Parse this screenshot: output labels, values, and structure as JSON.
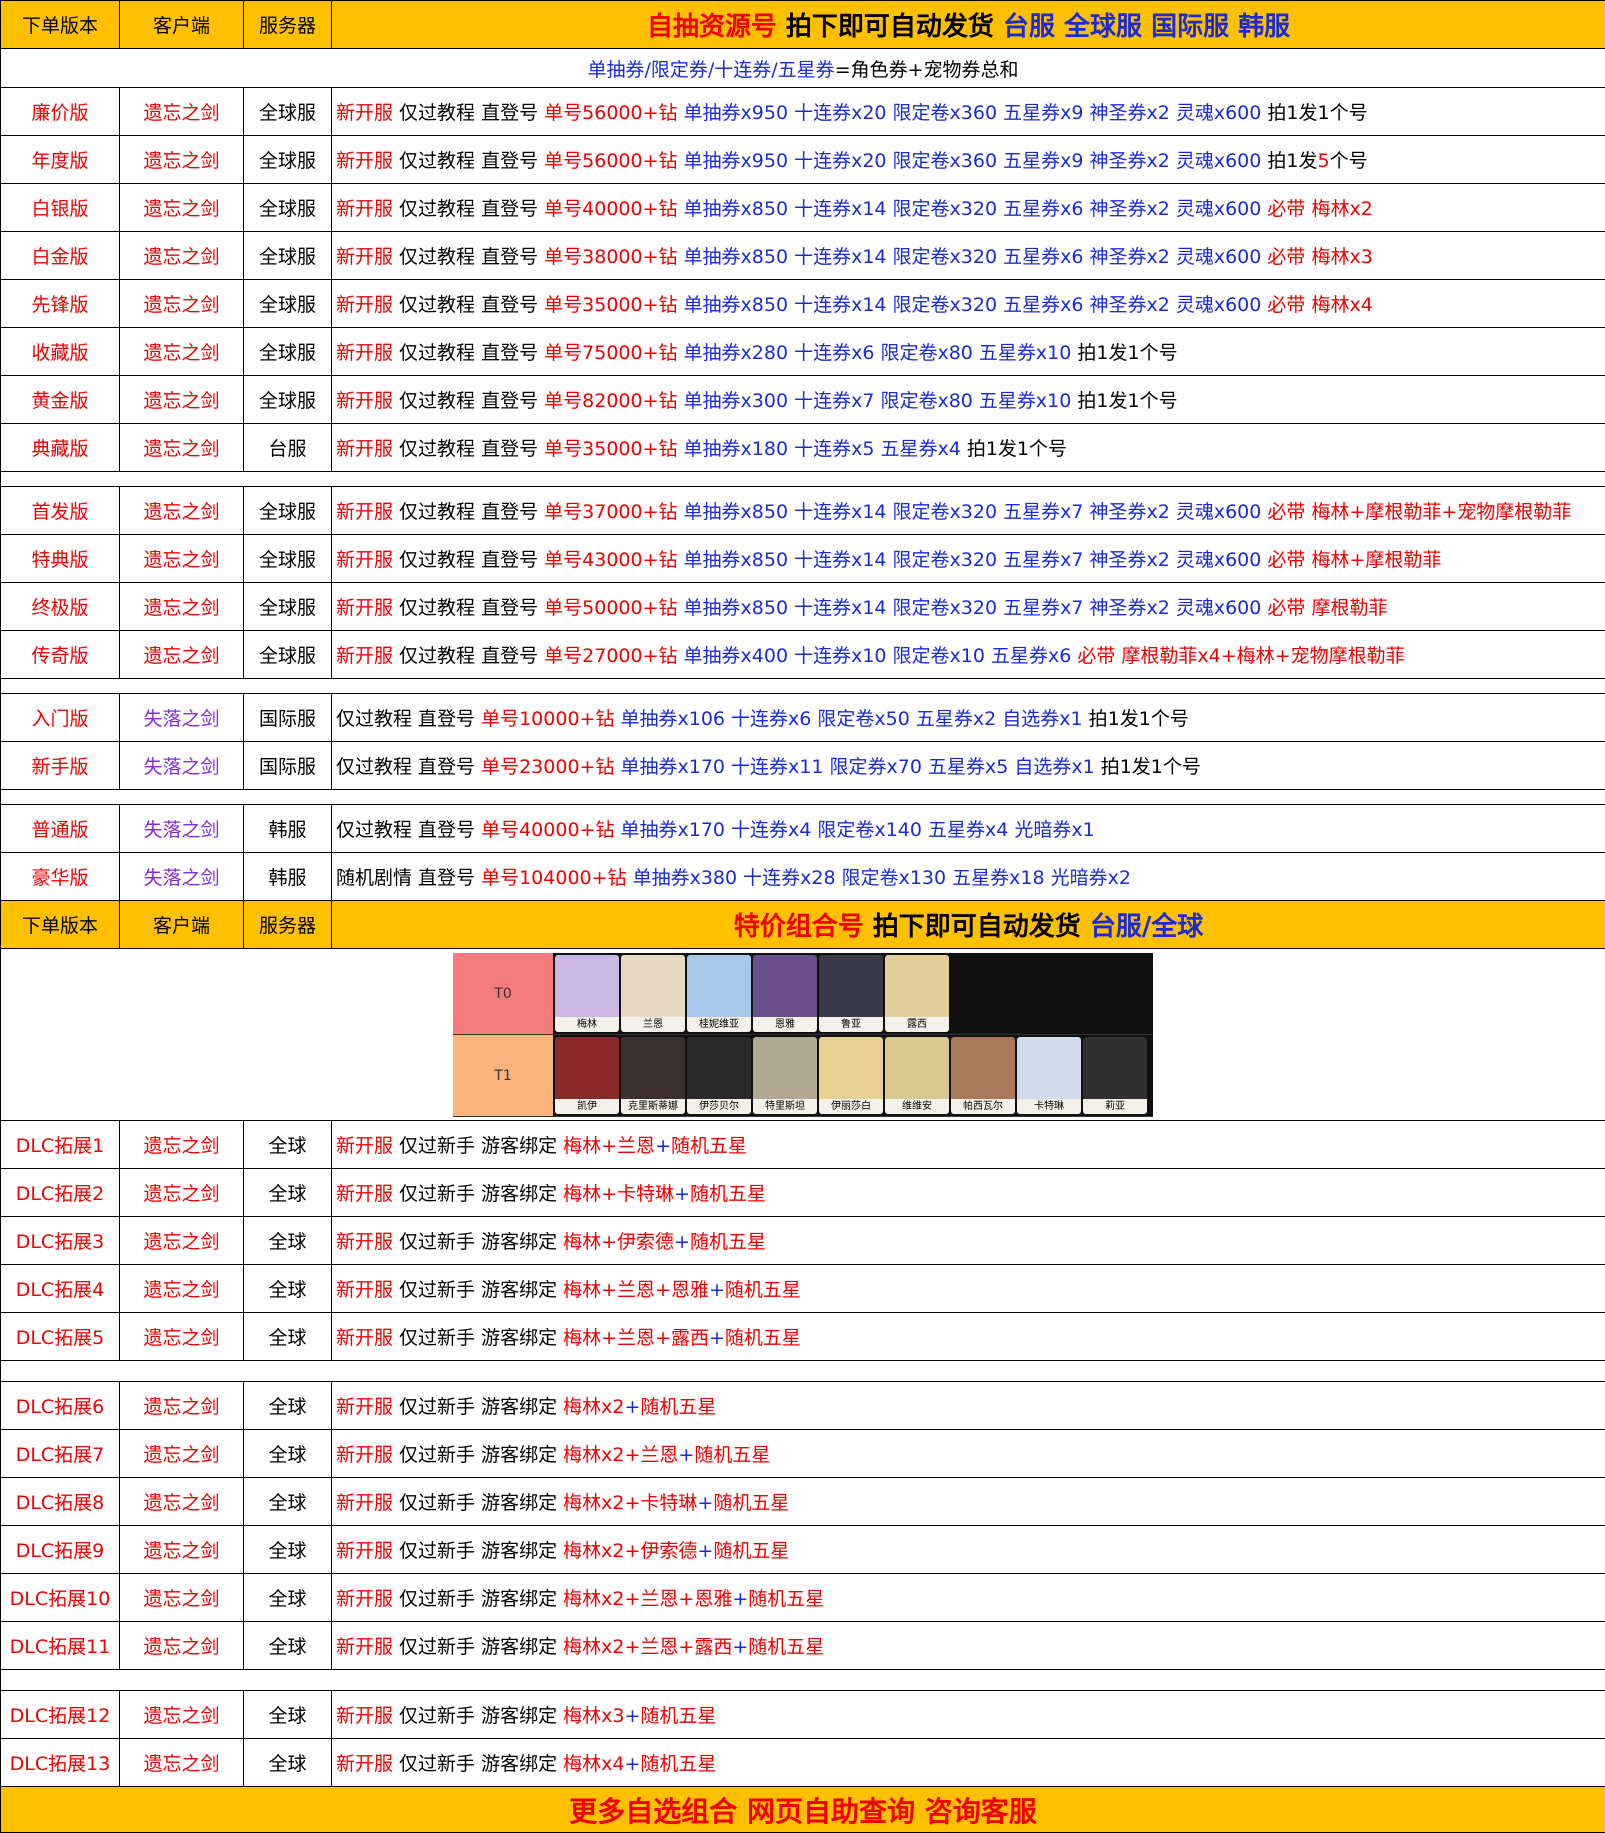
{
  "header": {
    "col_version": "下单版本",
    "col_client": "客户端",
    "col_server": "服务器",
    "title_parts": [
      {
        "t": "自抽资源号 ",
        "c": "red"
      },
      {
        "t": "拍下即可自动发货 ",
        "c": "blk"
      },
      {
        "t": "台服 全球服 国际服 韩服",
        "c": "blue"
      }
    ]
  },
  "subheader": [
    {
      "t": "单抽券/限定券/十连券/五星券",
      "c": "blue"
    },
    {
      "t": "=角色券+宠物券总和",
      "c": "blk"
    }
  ],
  "group1": [
    {
      "ver": "廉价版",
      "client": "遗忘之剑",
      "server": "全球服",
      "parts": [
        {
          "t": "新开服 ",
          "c": "red"
        },
        {
          "t": "仅过教程 直登号 ",
          "c": "blk"
        },
        {
          "t": "单号56000+钻 ",
          "c": "red"
        },
        {
          "t": "单抽券x950 十连券x20  限定卷x360 五星券x9 神圣券x2 灵魂x600 ",
          "c": "blue"
        },
        {
          "t": "拍1发1个号",
          "c": "blk"
        }
      ]
    },
    {
      "ver": "年度版",
      "client": "遗忘之剑",
      "server": "全球服",
      "parts": [
        {
          "t": "新开服 ",
          "c": "red"
        },
        {
          "t": "仅过教程 直登号 ",
          "c": "blk"
        },
        {
          "t": "单号56000+钻 ",
          "c": "red"
        },
        {
          "t": "单抽券x950 十连券x20  限定卷x360 五星券x9 神圣券x2 灵魂x600 ",
          "c": "blue"
        },
        {
          "t": "拍1发",
          "c": "blk"
        },
        {
          "t": "5",
          "c": "red"
        },
        {
          "t": "个号",
          "c": "blk"
        }
      ]
    },
    {
      "ver": "白银版",
      "client": "遗忘之剑",
      "server": "全球服",
      "parts": [
        {
          "t": "新开服 ",
          "c": "red"
        },
        {
          "t": "仅过教程 直登号 ",
          "c": "blk"
        },
        {
          "t": "单号40000+钻 ",
          "c": "red"
        },
        {
          "t": "单抽券x850 十连券x14  限定卷x320 五星券x6 神圣券x2 灵魂x600  ",
          "c": "blue"
        },
        {
          "t": "必带 梅林x2",
          "c": "red"
        }
      ]
    },
    {
      "ver": "白金版",
      "client": "遗忘之剑",
      "server": "全球服",
      "parts": [
        {
          "t": "新开服 ",
          "c": "red"
        },
        {
          "t": "仅过教程 直登号 ",
          "c": "blk"
        },
        {
          "t": "单号38000+钻 ",
          "c": "red"
        },
        {
          "t": "单抽券x850 十连券x14  限定卷x320 五星券x6 神圣券x2 灵魂x600  ",
          "c": "blue"
        },
        {
          "t": "必带 梅林x3",
          "c": "red"
        }
      ]
    },
    {
      "ver": "先锋版",
      "client": "遗忘之剑",
      "server": "全球服",
      "parts": [
        {
          "t": "新开服 ",
          "c": "red"
        },
        {
          "t": "仅过教程 直登号 ",
          "c": "blk"
        },
        {
          "t": "单号35000+钻 ",
          "c": "red"
        },
        {
          "t": "单抽券x850 十连券x14  限定卷x320 五星券x6 神圣券x2 灵魂x600  ",
          "c": "blue"
        },
        {
          "t": "必带 梅林x4",
          "c": "red"
        }
      ]
    },
    {
      "ver": "收藏版",
      "client": "遗忘之剑",
      "server": "全球服",
      "parts": [
        {
          "t": "新开服 ",
          "c": "red"
        },
        {
          "t": "仅过教程 直登号 ",
          "c": "blk"
        },
        {
          "t": "单号75000+钻 ",
          "c": "red"
        },
        {
          "t": "单抽券x280 十连券x6  限定卷x80 五星券x10 ",
          "c": "blue"
        },
        {
          "t": "拍1发1个号",
          "c": "blk"
        }
      ]
    },
    {
      "ver": "黄金版",
      "client": "遗忘之剑",
      "server": "全球服",
      "parts": [
        {
          "t": "新开服 ",
          "c": "red"
        },
        {
          "t": "仅过教程 直登号 ",
          "c": "blk"
        },
        {
          "t": "单号82000+钻 ",
          "c": "red"
        },
        {
          "t": "单抽券x300 十连券x7  限定卷x80 五星券x10 ",
          "c": "blue"
        },
        {
          "t": "拍1发1个号",
          "c": "blk"
        }
      ]
    },
    {
      "ver": "典藏版",
      "client": "遗忘之剑",
      "server": "台服",
      "parts": [
        {
          "t": "新开服 ",
          "c": "red"
        },
        {
          "t": "仅过教程 直登号 ",
          "c": "blk"
        },
        {
          "t": "单号35000+钻 ",
          "c": "red"
        },
        {
          "t": "单抽券x180 十连券x5  五星券x4 ",
          "c": "blue"
        },
        {
          "t": "拍1发1个号",
          "c": "blk"
        }
      ]
    }
  ],
  "group2": [
    {
      "ver": "首发版",
      "client": "遗忘之剑",
      "server": "全球服",
      "parts": [
        {
          "t": "新开服 ",
          "c": "red"
        },
        {
          "t": "仅过教程 直登号 ",
          "c": "blk"
        },
        {
          "t": "单号37000+钻 ",
          "c": "red"
        },
        {
          "t": "单抽券x850 十连券x14  限定卷x320 五星券x7 神圣券x2 灵魂x600  ",
          "c": "blue"
        },
        {
          "t": "必带 梅林+摩根勒菲+宠物摩根勒菲",
          "c": "red"
        }
      ]
    },
    {
      "ver": "特典版",
      "client": "遗忘之剑",
      "server": "全球服",
      "parts": [
        {
          "t": "新开服 ",
          "c": "red"
        },
        {
          "t": "仅过教程 直登号 ",
          "c": "blk"
        },
        {
          "t": "单号43000+钻 ",
          "c": "red"
        },
        {
          "t": "单抽券x850 十连券x14  限定卷x320 五星券x7 神圣券x2 灵魂x600  ",
          "c": "blue"
        },
        {
          "t": "必带 梅林+摩根勒菲",
          "c": "red"
        }
      ]
    },
    {
      "ver": "终极版",
      "client": "遗忘之剑",
      "server": "全球服",
      "parts": [
        {
          "t": "新开服 ",
          "c": "red"
        },
        {
          "t": "仅过教程 直登号 ",
          "c": "blk"
        },
        {
          "t": "单号50000+钻 ",
          "c": "red"
        },
        {
          "t": "单抽券x850 十连券x14  限定卷x320 五星券x7 神圣券x2 灵魂x600  ",
          "c": "blue"
        },
        {
          "t": "必带 摩根勒菲",
          "c": "red"
        }
      ]
    },
    {
      "ver": "传奇版",
      "client": "遗忘之剑",
      "server": "全球服",
      "parts": [
        {
          "t": "新开服 ",
          "c": "red"
        },
        {
          "t": "仅过教程 直登号 ",
          "c": "blk"
        },
        {
          "t": "单号27000+钻 ",
          "c": "red"
        },
        {
          "t": "单抽券x400 十连券x10  限定卷x10   五星券x6  ",
          "c": "blue"
        },
        {
          "t": "必带 摩根勒菲x4+梅林+宠物摩根勒菲",
          "c": "red"
        }
      ]
    }
  ],
  "group3": [
    {
      "ver": "入门版",
      "client": "失落之剑",
      "server": "国际服",
      "parts": [
        {
          "t": "仅过教程 直登号 ",
          "c": "blk"
        },
        {
          "t": "单号10000+钻 ",
          "c": "red"
        },
        {
          "t": "单抽券x106 十连券x6   限定卷x50 五星券x2 自选券x1 ",
          "c": "blue"
        },
        {
          "t": "拍1发1个号",
          "c": "blk"
        }
      ]
    },
    {
      "ver": "新手版",
      "client": "失落之剑",
      "server": "国际服",
      "parts": [
        {
          "t": "仅过教程 直登号 ",
          "c": "blk"
        },
        {
          "t": "单号23000+钻 ",
          "c": "red"
        },
        {
          "t": "单抽券x170 十连券x11 限定券x70 五星券x5 自选券x1 ",
          "c": "blue"
        },
        {
          "t": "拍1发1个号",
          "c": "blk"
        }
      ]
    }
  ],
  "group4": [
    {
      "ver": "普通版",
      "client": "失落之剑",
      "server": "韩服",
      "parts": [
        {
          "t": "仅过教程 直登号 ",
          "c": "blk"
        },
        {
          "t": "单号40000+钻 ",
          "c": "red"
        },
        {
          "t": "单抽券x170 十连券x4  限定卷x140  五星券x4  光暗券x1",
          "c": "blue"
        }
      ]
    },
    {
      "ver": "豪华版",
      "client": "失落之剑",
      "server": "韩服",
      "parts": [
        {
          "t": "随机剧情 直登号 ",
          "c": "blk"
        },
        {
          "t": "单号104000+钻 ",
          "c": "red"
        },
        {
          "t": "单抽券x380 十连券x28 限定卷x130 五星券x18 光暗券x2",
          "c": "blue"
        }
      ]
    }
  ],
  "header2": {
    "col_version": "下单版本",
    "col_client": "客户端",
    "col_server": "服务器",
    "title_parts": [
      {
        "t": "特价组合号 ",
        "c": "red"
      },
      {
        "t": "拍下即可自动发货 ",
        "c": "blk"
      },
      {
        "t": "台服/全球",
        "c": "blue"
      }
    ]
  },
  "tierlist": {
    "tiers": [
      {
        "label": "T0",
        "chars": [
          "梅林",
          "兰恩",
          "桂妮维亚",
          "恩雅",
          "鲁亚",
          "露西"
        ]
      },
      {
        "label": "T1",
        "chars": [
          "凯伊",
          "克里斯蒂娜",
          "伊莎贝尔",
          "特里斯坦",
          "伊丽莎白",
          "维维安",
          "帕西瓦尔",
          "卡特琳",
          "莉亚"
        ]
      }
    ]
  },
  "dlc1": [
    {
      "ver": "DLC拓展1",
      "client": "遗忘之剑",
      "server": "全球",
      "parts": [
        {
          "t": "新开服 ",
          "c": "red"
        },
        {
          "t": "仅过新手 游客绑定 ",
          "c": "blk"
        },
        {
          "t": "梅林+兰恩",
          "c": "red"
        },
        {
          "t": "+",
          "c": "blue"
        },
        {
          "t": "随机五星",
          "c": "red"
        }
      ]
    },
    {
      "ver": "DLC拓展2",
      "client": "遗忘之剑",
      "server": "全球",
      "parts": [
        {
          "t": "新开服 ",
          "c": "red"
        },
        {
          "t": "仅过新手 游客绑定 ",
          "c": "blk"
        },
        {
          "t": "梅林+卡特琳",
          "c": "red"
        },
        {
          "t": "+",
          "c": "blue"
        },
        {
          "t": "随机五星",
          "c": "red"
        }
      ]
    },
    {
      "ver": "DLC拓展3",
      "client": "遗忘之剑",
      "server": "全球",
      "parts": [
        {
          "t": "新开服 ",
          "c": "red"
        },
        {
          "t": "仅过新手 游客绑定 ",
          "c": "blk"
        },
        {
          "t": "梅林+伊索德",
          "c": "red"
        },
        {
          "t": "+",
          "c": "blue"
        },
        {
          "t": "随机五星",
          "c": "red"
        }
      ]
    },
    {
      "ver": "DLC拓展4",
      "client": "遗忘之剑",
      "server": "全球",
      "parts": [
        {
          "t": "新开服 ",
          "c": "red"
        },
        {
          "t": "仅过新手 游客绑定 ",
          "c": "blk"
        },
        {
          "t": "梅林+兰恩+恩雅",
          "c": "red"
        },
        {
          "t": "+",
          "c": "blue"
        },
        {
          "t": "随机五星",
          "c": "red"
        }
      ]
    },
    {
      "ver": "DLC拓展5",
      "client": "遗忘之剑",
      "server": "全球",
      "parts": [
        {
          "t": "新开服 ",
          "c": "red"
        },
        {
          "t": "仅过新手 游客绑定 ",
          "c": "blk"
        },
        {
          "t": "梅林+兰恩+露西",
          "c": "red"
        },
        {
          "t": "+",
          "c": "blue"
        },
        {
          "t": "随机五星",
          "c": "red"
        }
      ]
    }
  ],
  "dlc2": [
    {
      "ver": "DLC拓展6",
      "client": "遗忘之剑",
      "server": "全球",
      "parts": [
        {
          "t": "新开服 ",
          "c": "red"
        },
        {
          "t": "仅过新手 游客绑定 ",
          "c": "blk"
        },
        {
          "t": "梅林x2",
          "c": "red"
        },
        {
          "t": "+",
          "c": "blue"
        },
        {
          "t": "随机五星",
          "c": "red"
        }
      ]
    },
    {
      "ver": "DLC拓展7",
      "client": "遗忘之剑",
      "server": "全球",
      "parts": [
        {
          "t": "新开服 ",
          "c": "red"
        },
        {
          "t": "仅过新手 游客绑定 ",
          "c": "blk"
        },
        {
          "t": "梅林x2+兰恩",
          "c": "red"
        },
        {
          "t": "+",
          "c": "blue"
        },
        {
          "t": "随机五星",
          "c": "red"
        }
      ]
    },
    {
      "ver": "DLC拓展8",
      "client": "遗忘之剑",
      "server": "全球",
      "parts": [
        {
          "t": "新开服 ",
          "c": "red"
        },
        {
          "t": "仅过新手 游客绑定 ",
          "c": "blk"
        },
        {
          "t": "梅林x2+卡特琳",
          "c": "red"
        },
        {
          "t": "+",
          "c": "blue"
        },
        {
          "t": "随机五星",
          "c": "red"
        }
      ]
    },
    {
      "ver": "DLC拓展9",
      "client": "遗忘之剑",
      "server": "全球",
      "parts": [
        {
          "t": "新开服 ",
          "c": "red"
        },
        {
          "t": "仅过新手 游客绑定 ",
          "c": "blk"
        },
        {
          "t": "梅林x2+伊索德",
          "c": "red"
        },
        {
          "t": "+",
          "c": "blue"
        },
        {
          "t": "随机五星",
          "c": "red"
        }
      ]
    },
    {
      "ver": "DLC拓展10",
      "client": "遗忘之剑",
      "server": "全球",
      "parts": [
        {
          "t": "新开服 ",
          "c": "red"
        },
        {
          "t": "仅过新手 游客绑定 ",
          "c": "blk"
        },
        {
          "t": "梅林x2+兰恩+恩雅",
          "c": "red"
        },
        {
          "t": "+",
          "c": "blue"
        },
        {
          "t": "随机五星",
          "c": "red"
        }
      ]
    },
    {
      "ver": "DLC拓展11",
      "client": "遗忘之剑",
      "server": "全球",
      "parts": [
        {
          "t": "新开服 ",
          "c": "red"
        },
        {
          "t": "仅过新手 游客绑定 ",
          "c": "blk"
        },
        {
          "t": "梅林x2+兰恩+露西",
          "c": "red"
        },
        {
          "t": "+",
          "c": "blue"
        },
        {
          "t": "随机五星",
          "c": "red"
        }
      ]
    }
  ],
  "dlc3": [
    {
      "ver": "DLC拓展12",
      "client": "遗忘之剑",
      "server": "全球",
      "parts": [
        {
          "t": "新开服 ",
          "c": "red"
        },
        {
          "t": "仅过新手 游客绑定 ",
          "c": "blk"
        },
        {
          "t": "梅林x3",
          "c": "red"
        },
        {
          "t": "+",
          "c": "blue"
        },
        {
          "t": "随机五星",
          "c": "red"
        }
      ]
    },
    {
      "ver": "DLC拓展13",
      "client": "遗忘之剑",
      "server": "全球",
      "parts": [
        {
          "t": "新开服 ",
          "c": "red"
        },
        {
          "t": "仅过新手 游客绑定 ",
          "c": "blk"
        },
        {
          "t": "梅林x4",
          "c": "red"
        },
        {
          "t": "+",
          "c": "blue"
        },
        {
          "t": "随机五星",
          "c": "red"
        }
      ]
    }
  ],
  "footer": {
    "text": "更多自选组合 网页自助查询 咨询客服"
  },
  "colors": {
    "red": "#F00000",
    "blue": "#1A2BD6",
    "purple": "#8A2BD6",
    "header_bg": "#FFC000"
  }
}
